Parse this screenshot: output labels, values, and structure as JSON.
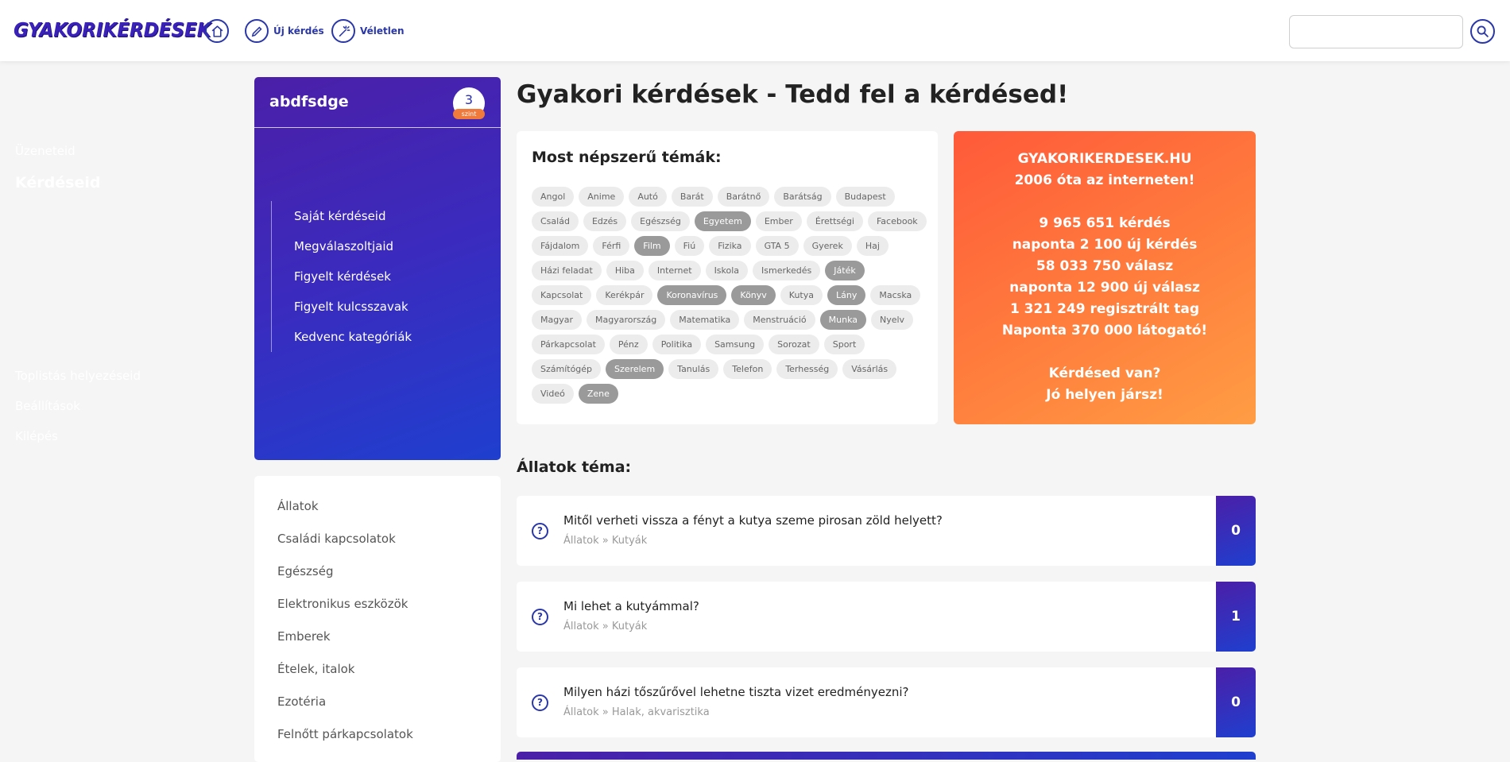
{
  "header": {
    "logo": "GYAKORIKÉRDÉSEK",
    "nav": [
      {
        "icon": "home-icon",
        "label": ""
      },
      {
        "icon": "pencil-icon",
        "label": "Új kérdés"
      },
      {
        "icon": "magic-wand-icon",
        "label": "Véletlen"
      }
    ],
    "search_value": "",
    "search_icon": "search-icon"
  },
  "user": {
    "name": "abdfsdge",
    "level": "3",
    "level_label": "szint",
    "menu": [
      {
        "label": "Üzeneteid"
      },
      {
        "label": "Kérdéseid"
      },
      {
        "label": "Saját kérdéseid"
      },
      {
        "label": "Megválaszoltjaid"
      },
      {
        "label": "Figyelt kérdések"
      },
      {
        "label": "Figyelt kulcsszavak"
      },
      {
        "label": "Kedvenc kategóriák"
      },
      {
        "label": "Toplistás helyezéseid"
      },
      {
        "label": "Beállítások"
      },
      {
        "label": "Kilépés"
      }
    ]
  },
  "categories": [
    "Állatok",
    "Családi kapcsolatok",
    "Egészség",
    "Elektronikus eszközök",
    "Emberek",
    "Ételek, italok",
    "Ezotéria",
    "Felnőtt párkapcsolatok"
  ],
  "main": {
    "title": "Gyakori kérdések - Tedd fel a kérdésed!",
    "topics_title": "Most népszerű témák:",
    "tags": [
      {
        "label": "Angol",
        "hot": false
      },
      {
        "label": "Anime",
        "hot": false
      },
      {
        "label": "Autó",
        "hot": false
      },
      {
        "label": "Barát",
        "hot": false
      },
      {
        "label": "Barátnő",
        "hot": false
      },
      {
        "label": "Barátság",
        "hot": false
      },
      {
        "label": "Budapest",
        "hot": false
      },
      {
        "label": "Család",
        "hot": false
      },
      {
        "label": "Edzés",
        "hot": false
      },
      {
        "label": "Egészség",
        "hot": false
      },
      {
        "label": "Egyetem",
        "hot": true
      },
      {
        "label": "Ember",
        "hot": false
      },
      {
        "label": "Érettségi",
        "hot": false
      },
      {
        "label": "Facebook",
        "hot": false
      },
      {
        "label": "Fájdalom",
        "hot": false
      },
      {
        "label": "Férfi",
        "hot": false
      },
      {
        "label": "Film",
        "hot": true
      },
      {
        "label": "Fiú",
        "hot": false
      },
      {
        "label": "Fizika",
        "hot": false
      },
      {
        "label": "GTA 5",
        "hot": false
      },
      {
        "label": "Gyerek",
        "hot": false
      },
      {
        "label": "Haj",
        "hot": false
      },
      {
        "label": "Házi feladat",
        "hot": false
      },
      {
        "label": "Hiba",
        "hot": false
      },
      {
        "label": "Internet",
        "hot": false
      },
      {
        "label": "Iskola",
        "hot": false
      },
      {
        "label": "Ismerkedés",
        "hot": false
      },
      {
        "label": "Játék",
        "hot": true
      },
      {
        "label": "Kapcsolat",
        "hot": false
      },
      {
        "label": "Kerékpár",
        "hot": false
      },
      {
        "label": "Koronavírus",
        "hot": true
      },
      {
        "label": "Könyv",
        "hot": true
      },
      {
        "label": "Kutya",
        "hot": false
      },
      {
        "label": "Lány",
        "hot": true
      },
      {
        "label": "Macska",
        "hot": false
      },
      {
        "label": "Magyar",
        "hot": false
      },
      {
        "label": "Magyarország",
        "hot": false
      },
      {
        "label": "Matematika",
        "hot": false
      },
      {
        "label": "Menstruáció",
        "hot": false
      },
      {
        "label": "Munka",
        "hot": true
      },
      {
        "label": "Nyelv",
        "hot": false
      },
      {
        "label": "Párkapcsolat",
        "hot": false
      },
      {
        "label": "Pénz",
        "hot": false
      },
      {
        "label": "Politika",
        "hot": false
      },
      {
        "label": "Samsung",
        "hot": false
      },
      {
        "label": "Sorozat",
        "hot": false
      },
      {
        "label": "Sport",
        "hot": false
      },
      {
        "label": "Számítógép",
        "hot": false
      },
      {
        "label": "Szerelem",
        "hot": true
      },
      {
        "label": "Tanulás",
        "hot": false
      },
      {
        "label": "Telefon",
        "hot": false
      },
      {
        "label": "Terhesség",
        "hot": false
      },
      {
        "label": "Vásárlás",
        "hot": false
      },
      {
        "label": "Videó",
        "hot": false
      },
      {
        "label": "Zene",
        "hot": true
      }
    ],
    "promo": {
      "line1": "GYAKORIKERDESEK.HU",
      "line2": "2006 óta az interneten!",
      "line3": "9 965 651 kérdés",
      "line4": "naponta 2 100 új kérdés",
      "line5": "58 033 750 válasz",
      "line6": "naponta 12 900 új válasz",
      "line7": "1 321 249 regisztrált tag",
      "line8": "Naponta 370 000 látogató!",
      "line9": "Kérdésed van?",
      "line10": "Jó helyen jársz!"
    },
    "section_title": "Állatok téma:",
    "questions": [
      {
        "title": "Mitől verheti vissza a fényt a kutya szeme pirosan zöld helyett?",
        "category": "Állatok » Kutyák",
        "answers": "0"
      },
      {
        "title": "Mi lehet a kutyámmal?",
        "category": "Állatok » Kutyák",
        "answers": "1"
      },
      {
        "title": "Milyen házi tőszűrővel lehetne tiszta vizet eredményezni?",
        "category": "Állatok » Halak, akvarisztika",
        "answers": "0"
      }
    ]
  },
  "colors": {
    "brand": "#2a37a8",
    "sidebar_gradient_start": "#4b1fa8",
    "sidebar_gradient_end": "#1f3fcf",
    "promo_start": "#ff5a3a",
    "promo_end": "#ff9d44",
    "hot_tag": "#9a9a9a"
  }
}
